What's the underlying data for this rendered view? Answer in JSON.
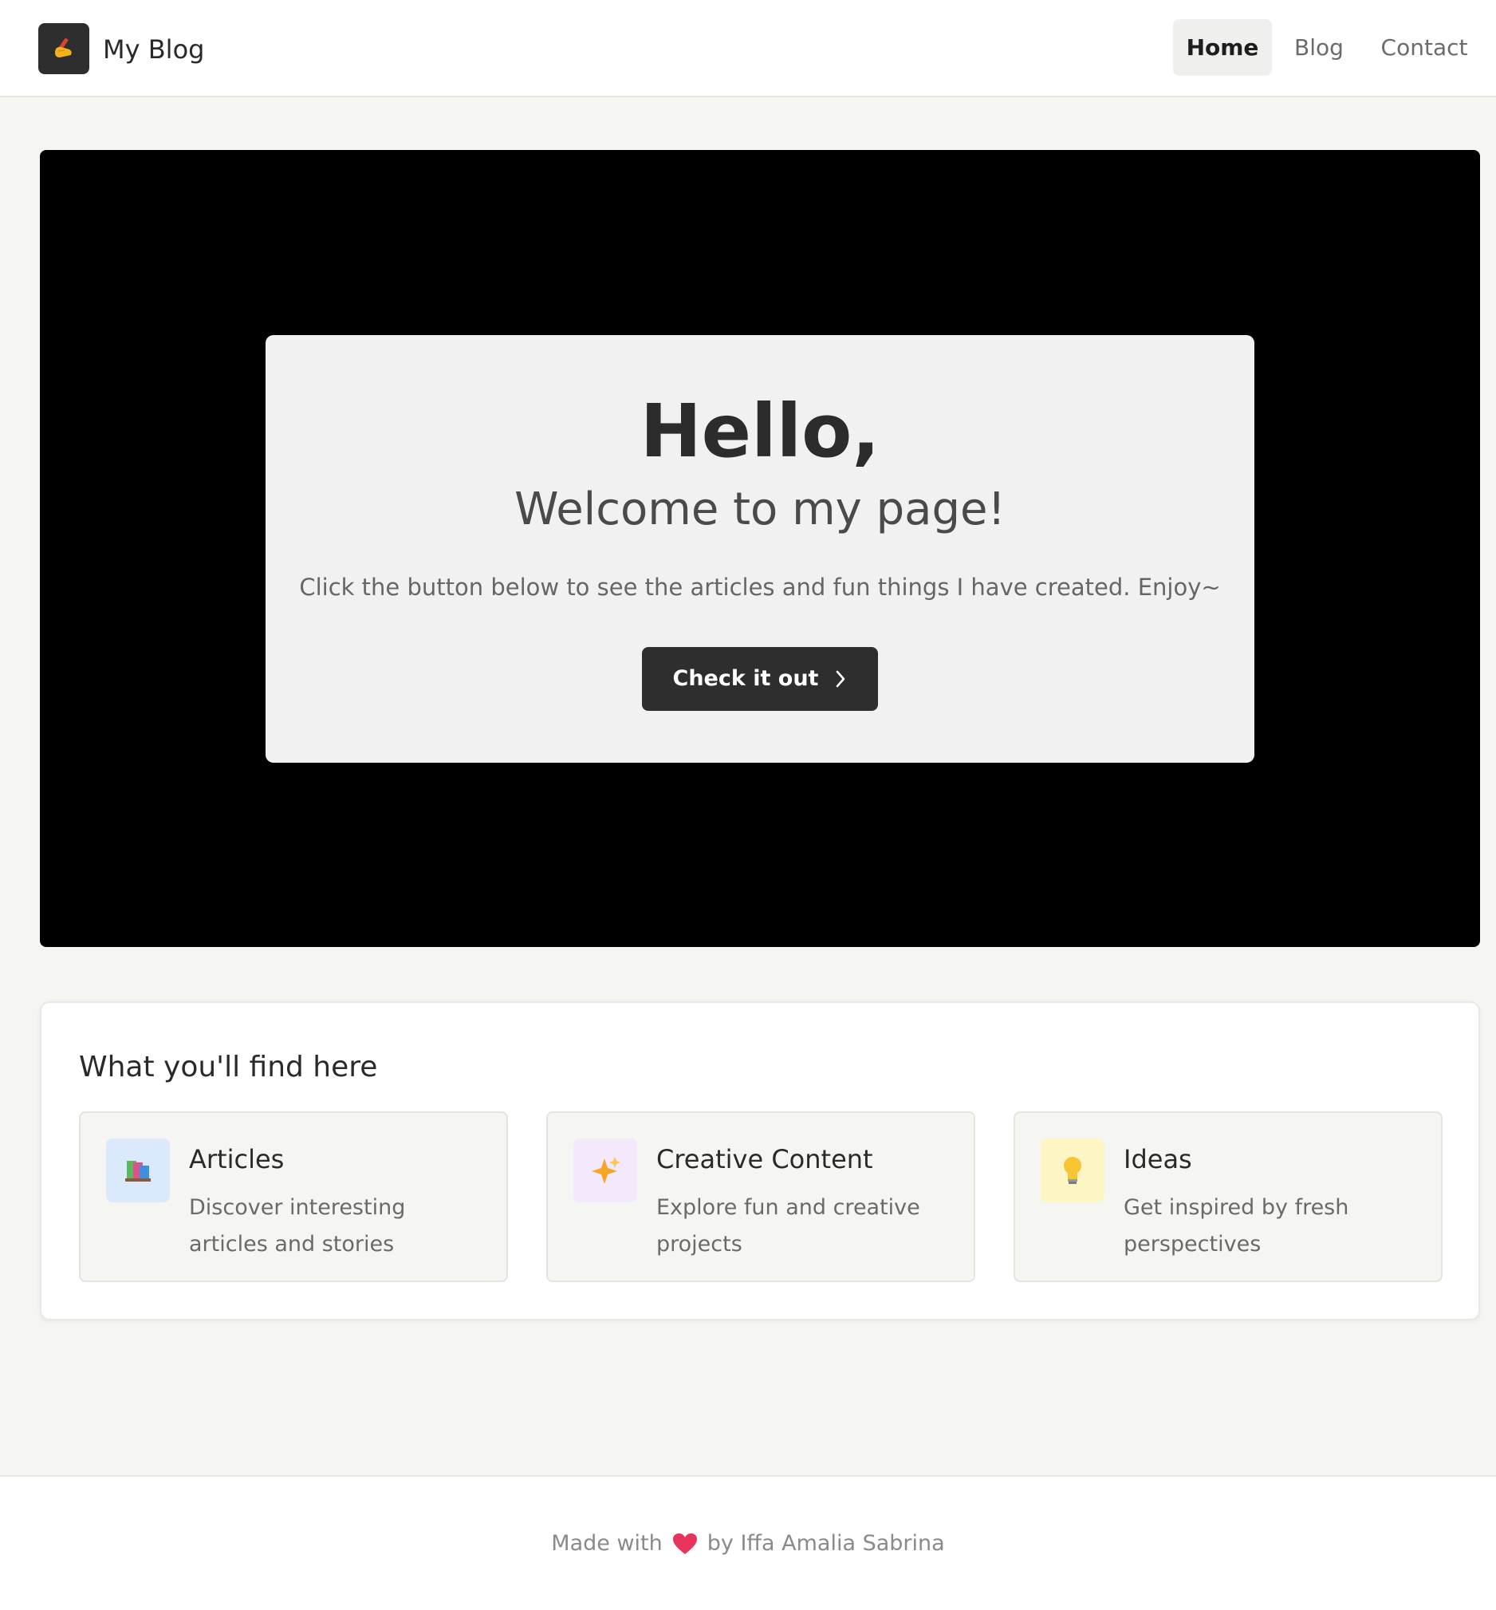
{
  "header": {
    "logo_icon": "writing-hand-icon",
    "brand": "My Blog",
    "nav": [
      {
        "label": "Home",
        "active": true
      },
      {
        "label": "Blog",
        "active": false
      },
      {
        "label": "Contact",
        "active": false
      }
    ]
  },
  "hero": {
    "title": "Hello,",
    "subtitle": "Welcome to my page!",
    "description": "Click the button below to see the articles and fun things I have created. Enjoy~",
    "cta_label": "Check it out",
    "cta_icon": "chevron-right-icon"
  },
  "features": {
    "title": "What you'll find here",
    "cards": [
      {
        "icon": "books-icon",
        "title": "Articles",
        "description": "Discover interesting articles and stories"
      },
      {
        "icon": "sparkles-icon",
        "title": "Creative Content",
        "description": "Explore fun and creative projects"
      },
      {
        "icon": "lightbulb-icon",
        "title": "Ideas",
        "description": "Get inspired by fresh perspectives"
      }
    ]
  },
  "footer": {
    "made_with": "Made with",
    "heart_icon": "heart-icon",
    "by": "by Iffa Amalia Sabrina"
  },
  "colors": {
    "background": "#f5f5f2",
    "hero_bg": "#000000",
    "button_bg": "#2e2e2e",
    "heart": "#e8335a"
  }
}
